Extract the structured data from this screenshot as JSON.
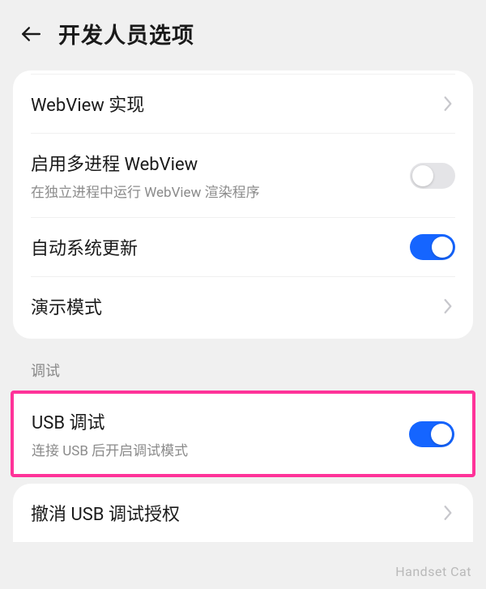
{
  "header": {
    "title": "开发人员选项"
  },
  "group1": {
    "webview_impl": {
      "label": "WebView 实现"
    },
    "multiprocess_webview": {
      "label": "启用多进程 WebView",
      "sub": "在独立进程中运行 WebView 渲染程序",
      "on": false
    },
    "auto_system_update": {
      "label": "自动系统更新",
      "on": true
    },
    "demo_mode": {
      "label": "演示模式"
    }
  },
  "section_debug": {
    "header": "调试"
  },
  "group2": {
    "usb_debugging": {
      "label": "USB 调试",
      "sub": "连接 USB 后开启调试模式",
      "on": true
    },
    "revoke_usb": {
      "label": "撤消 USB 调试授权"
    }
  },
  "watermark": "Handset Cat",
  "colors": {
    "accent": "#1565ff",
    "highlight": "#ff3399"
  }
}
